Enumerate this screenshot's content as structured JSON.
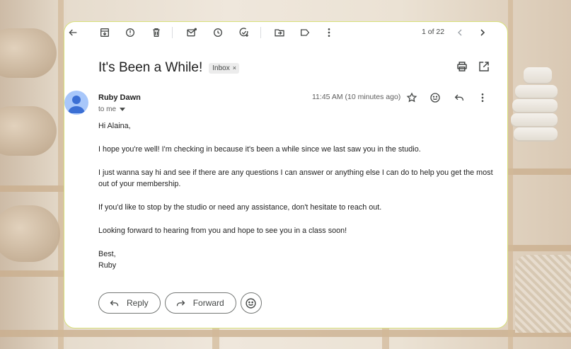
{
  "toolbar": {
    "icons": [
      "back-arrow-icon",
      "archive-icon",
      "report-spam-icon",
      "delete-icon",
      "mark-unread-icon",
      "snooze-icon",
      "add-task-icon",
      "move-to-icon",
      "labels-icon",
      "more-vert-icon",
      "chevron-left-icon",
      "chevron-right-icon"
    ],
    "counter": "1 of 22"
  },
  "email": {
    "subject": "It's Been a While!",
    "label": "Inbox",
    "label_close": "×",
    "sender": "Ruby Dawn",
    "recipient": "to me",
    "time": "11:45 AM (10 minutes ago)",
    "body": [
      "Hi Alaina,",
      "I hope you're well! I'm checking in because it's been a while since we last saw you in the studio.",
      "I just wanna say hi and see if there are any questions I can answer or anything else I can do to help you get the most out of your membership.",
      "If you'd like to stop by the studio or need any assistance, don't hesitate to reach out.",
      "Looking forward to hearing from you and hope to see you in a class soon!"
    ],
    "signoff": "Best,",
    "signature": "Ruby"
  },
  "actions": {
    "reply_label": "Reply",
    "forward_label": "Forward"
  }
}
